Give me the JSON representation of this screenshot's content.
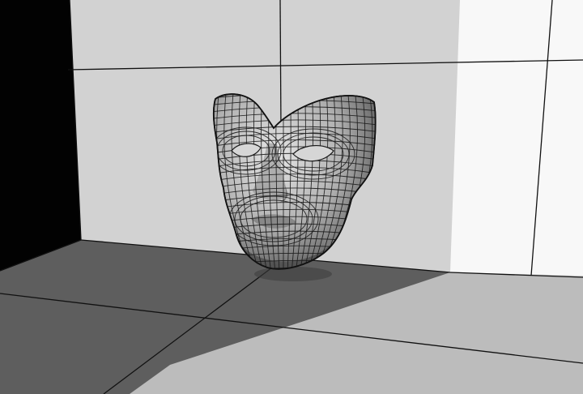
{
  "scene": {
    "subject": "wireframe mask",
    "colors": {
      "left_wall_shadow": "#020202",
      "back_wall": "#d2d2d2",
      "back_wall_lit": "#f8f8f8",
      "floor_shadow": "#5e5e5e",
      "floor_lit": "#bcbcbc",
      "grid_line": "#111111",
      "mesh_line": "#1a1a1a",
      "mask_light": "#e2e2e2",
      "mask_mid": "#a8a8a8",
      "mask_dark": "#4a4a4a"
    },
    "icons": [
      "mask-mesh-icon"
    ]
  }
}
